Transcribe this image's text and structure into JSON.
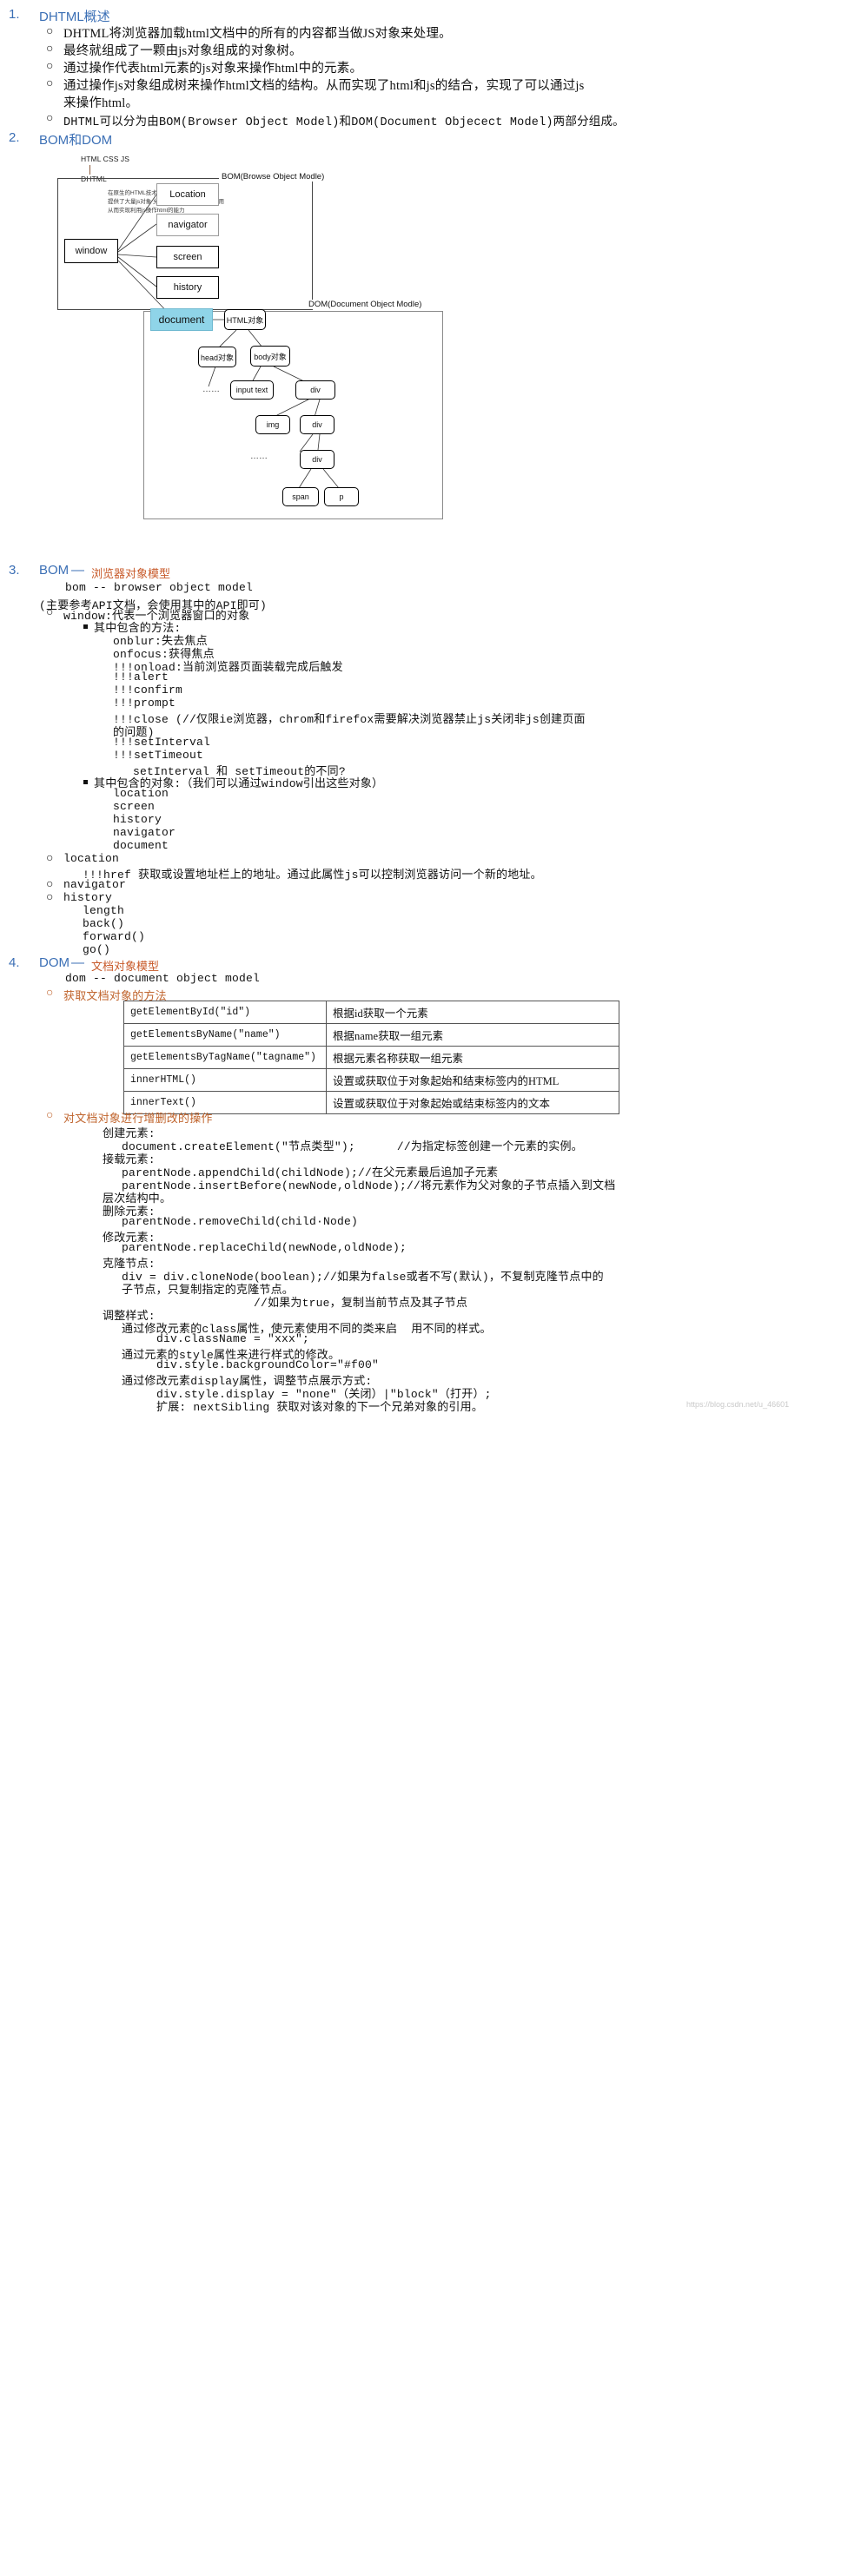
{
  "sections": {
    "s1": {
      "num": "1.",
      "title": "DHTML概述",
      "items": [
        "DHTML将浏览器加载html文档中的所有的内容都当做JS对象来处理。",
        "最终就组成了一颗由js对象组成的对象树。",
        "通过操作代表html元素的js对象来操作html中的元素。",
        "通过操作js对象组成树来操作html文档的结构。从而实现了html和js的结合，实现了可以通过js",
        "来操作html。",
        "DHTML可以分为由BOM(Browser Object Model)和DOM(Document Objecect Model)两部分组成。"
      ]
    },
    "s2": {
      "num": "2.",
      "title": "BOM和DOM",
      "intro": {
        "l1": "HTML CSS JS",
        "l2": "DHTML",
        "r1": "在原生的HTML技术之上 增加了js访问的接口",
        "r2": "提供了大量js对象 允许通过在html中嵌入js使用",
        "r3": "从而实现利用js操作html的能力"
      }
    },
    "s3": {
      "num": "3.",
      "title": "BOM",
      "dash": "—",
      "subtitle": "浏览器对象模型",
      "l1": "bom -- browser object model",
      "l2": "(主要参考API文档，会使用其中的API即可)",
      "window_label": "window:代表一个浏览器窗口的对象",
      "methods_label": "其中包含的方法:",
      "methods": [
        "onblur:失去焦点",
        "onfocus:获得焦点",
        "!!!onload:当前浏览器页面装载完成后触发",
        "!!!alert",
        "!!!confirm",
        "!!!prompt",
        "!!!close (//仅限ie浏览器，chrom和firefox需要解决浏览器禁止js关闭非js创建页面",
        "的问题)",
        "!!!setInterval",
        "!!!setTimeout",
        "setInterval 和 setTimeout的不同?"
      ],
      "objects_label": "其中包含的对象:（我们可以通过window引出这些对象）",
      "objects": [
        "location",
        "screen",
        "history",
        "navigator",
        "document"
      ],
      "location_label": "location",
      "location_detail": "!!!href 获取或设置地址栏上的地址。通过此属性js可以控制浏览器访问一个新的地址。",
      "navigator_label": "navigator",
      "history_label": "history",
      "history_items": [
        "length",
        "back()",
        "forward()",
        "go()"
      ]
    },
    "s4": {
      "num": "4.",
      "title": "DOM",
      "dash": "—",
      "subtitle": "文档对象模型",
      "l1": "dom -- document object model",
      "sub1": "获取文档对象的方法",
      "sub2": "对文档对象进行增删改的操作",
      "ops": [
        {
          "head": "创建元素:",
          "lines": [
            "document.createElement(\"节点类型\");      //为指定标签创建一个元素的实例。"
          ]
        },
        {
          "head": "接载元素:",
          "lines": [
            "parentNode.appendChild(childNode);//在父元素最后追加子元素",
            "parentNode.insertBefore(newNode,oldNode);//将元素作为父对象的子节点插入到文档",
            "层次结构中。"
          ]
        },
        {
          "head": "删除元素:",
          "lines": [
            "parentNode.removeChild(child·Node)"
          ]
        },
        {
          "head": "修改元素:",
          "lines": [
            "parentNode.replaceChild(newNode,oldNode);"
          ]
        },
        {
          "head": "克隆节点:",
          "lines": [
            "div = div.cloneNode(boolean);//如果为false或者不写(默认)，不复制克隆节点中的",
            "子节点，只复制指定的克隆节点。",
            "                   //如果为true，复制当前节点及其子节点"
          ]
        },
        {
          "head": "调整样式:",
          "lines": [
            "通过修改元素的class属性，使元素使用不同的类来启  用不同的样式。",
            "     div.className = \"xxx\";",
            "通过元素的style属性来进行样式的修改。",
            "     div.style.backgroundColor=\"#f00\"",
            "通过修改元素display属性，调整节点展示方式:",
            "     div.style.display = \"none\"（关闭）|\"block\"（打开）;",
            "     扩展: nextSibling 获取对该对象的下一个兄弟对象的引用。"
          ]
        }
      ]
    }
  },
  "api_table": {
    "rows": [
      {
        "api": "getElementById(\"id\")",
        "desc": "根据id获取一个元素"
      },
      {
        "api": "getElementsByName(\"name\")",
        "desc": "根据name获取一组元素"
      },
      {
        "api": "getElementsByTagName(\"tagname\")",
        "desc": "根据元素名称获取一组元素"
      },
      {
        "api": "innerHTML()",
        "desc": "设置或获取位于对象起始和结束标签内的HTML"
      },
      {
        "api": "innerText()",
        "desc": "设置或获取位于对象起始或结束标签内的文本"
      }
    ]
  },
  "diagram": {
    "bom_label": "BOM(Browse Object Modle)",
    "dom_label": "DOM(Document Object Modle)",
    "window": "window",
    "bom_children": [
      "Location",
      "navigator",
      "screen",
      "history"
    ],
    "document": "document",
    "html_obj": "HTML对象",
    "head_obj": "head对象",
    "body_obj": "body对象",
    "input_text": "input text",
    "div1": "div",
    "img": "img",
    "div2": "div",
    "div3": "div",
    "span": "span",
    "p": "p",
    "ellipsis": "……"
  },
  "watermark": "https://blog.csdn.net/u_46601"
}
